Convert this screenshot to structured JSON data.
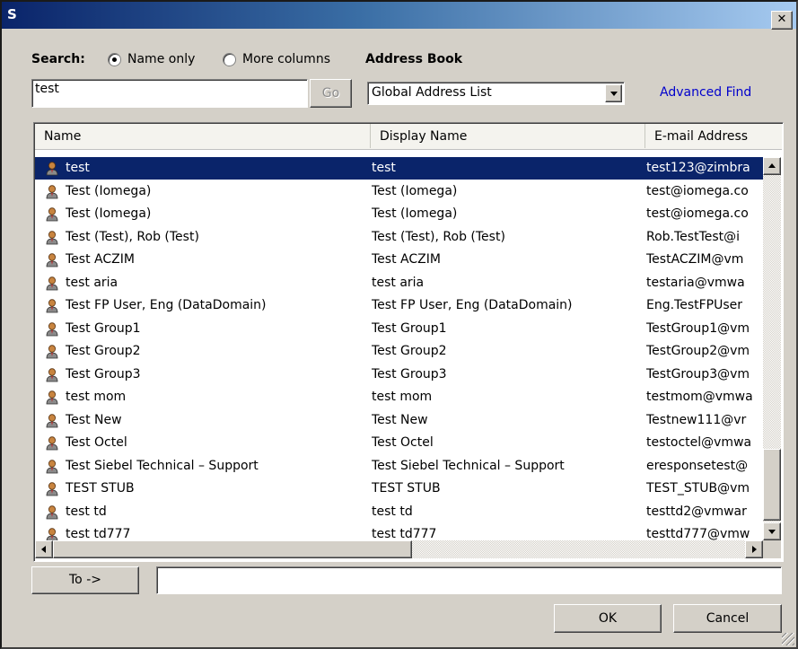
{
  "window": {
    "title": "S",
    "close_glyph": "✕"
  },
  "search": {
    "label": "Search:",
    "option_name_only": "Name only",
    "option_more_columns": "More columns",
    "selected": "Name only",
    "query": "test",
    "go_label": "Go"
  },
  "address_book": {
    "label": "Address Book",
    "selected": "Global Address List",
    "advanced_find": "Advanced Find"
  },
  "columns": {
    "name": "Name",
    "display_name": "Display Name",
    "email": "E-mail Address"
  },
  "rows": [
    {
      "name": "test",
      "display": "test",
      "email": "test123@zimbra",
      "selected": true
    },
    {
      "name": "Test (Iomega)",
      "display": "Test (Iomega)",
      "email": "test@iomega.co"
    },
    {
      "name": "Test (Iomega)",
      "display": "Test (Iomega)",
      "email": "test@iomega.co"
    },
    {
      "name": "Test (Test), Rob (Test)",
      "display": "Test (Test), Rob (Test)",
      "email": "Rob.TestTest@i"
    },
    {
      "name": "Test ACZIM",
      "display": "Test ACZIM",
      "email": "TestACZIM@vm"
    },
    {
      "name": "test aria",
      "display": "test aria",
      "email": "testaria@vmwa"
    },
    {
      "name": "Test FP User, Eng (DataDomain)",
      "display": "Test FP User, Eng (DataDomain)",
      "email": "Eng.TestFPUser"
    },
    {
      "name": "Test Group1",
      "display": "Test Group1",
      "email": "TestGroup1@vm"
    },
    {
      "name": "Test Group2",
      "display": "Test Group2",
      "email": "TestGroup2@vm"
    },
    {
      "name": "Test Group3",
      "display": "Test Group3",
      "email": "TestGroup3@vm"
    },
    {
      "name": "test mom",
      "display": "test mom",
      "email": "testmom@vmwa"
    },
    {
      "name": "Test New",
      "display": "Test New",
      "email": "Testnew111@vr"
    },
    {
      "name": "Test Octel",
      "display": "Test Octel",
      "email": "testoctel@vmwa"
    },
    {
      "name": "Test Siebel Technical – Support",
      "display": "Test Siebel Technical – Support",
      "email": "eresponsetest@"
    },
    {
      "name": "TEST STUB",
      "display": "TEST STUB",
      "email": "TEST_STUB@vm"
    },
    {
      "name": "test td",
      "display": "test td",
      "email": "testtd2@vmwar"
    },
    {
      "name": "test td777",
      "display": "test td777",
      "email": "testtd777@vmw"
    }
  ],
  "to_button": "To ->",
  "to_field": "",
  "ok_label": "OK",
  "cancel_label": "Cancel",
  "colors": {
    "selection": "#0a246a",
    "link": "#0000cc",
    "face": "#d4d0c8"
  },
  "icons": {
    "contact": "person-icon"
  }
}
